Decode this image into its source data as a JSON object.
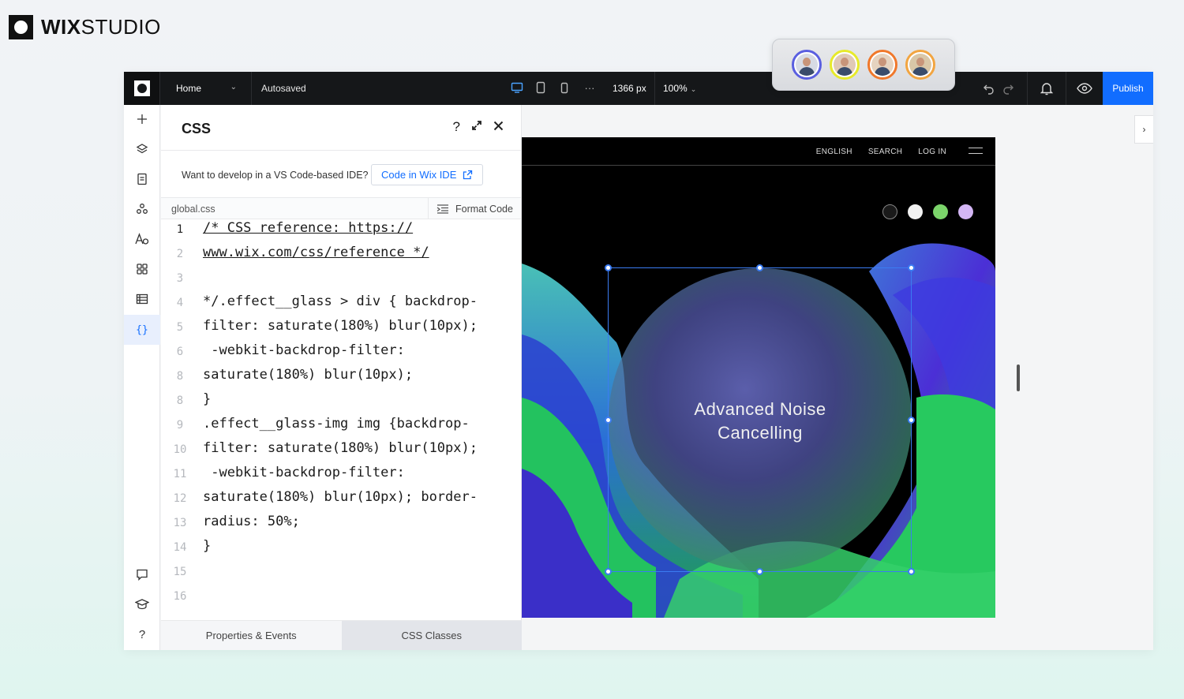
{
  "brand": {
    "bold": "WIX",
    "light": "STUDIO"
  },
  "topbar": {
    "page": "Home",
    "status": "Autosaved",
    "width": "1366 px",
    "zoom": "100%",
    "more": "···",
    "publish": "Publish"
  },
  "collaborators": [
    {
      "ring": "#5a5fe0",
      "bg": "#d7dbe4"
    },
    {
      "ring": "#e7ea2b",
      "bg": "#e0c9b6"
    },
    {
      "ring": "#f0782b",
      "bg": "#e5d3c0"
    },
    {
      "ring": "#f2a541",
      "bg": "#d9c7a8"
    }
  ],
  "panel": {
    "title": "CSS",
    "ide_prompt": "Want to develop in a VS Code-based IDE?",
    "ide_button": "Code in Wix IDE",
    "file": "global.css",
    "format": "Format Code",
    "lines": [
      {
        "n": "1",
        "t": "/* CSS reference: https://"
      },
      {
        "n": "2",
        "t": "www.wix.com/css/reference */"
      },
      {
        "n": "3",
        "t": ""
      },
      {
        "n": "4",
        "t": "*/.effect__glass > div { backdrop-"
      },
      {
        "n": "5",
        "t": "filter: saturate(180%) blur(10px);"
      },
      {
        "n": "6",
        "t": " -webkit-backdrop-filter:"
      },
      {
        "n": "8",
        "t": "saturate(180%) blur(10px);"
      },
      {
        "n": "8",
        "t": "}"
      },
      {
        "n": "9",
        "t": ".effect__glass-img img {backdrop-"
      },
      {
        "n": "10",
        "t": "filter: saturate(180%) blur(10px);"
      },
      {
        "n": "11",
        "t": " -webkit-backdrop-filter:"
      },
      {
        "n": "12",
        "t": "saturate(180%) blur(10px); border-"
      },
      {
        "n": "13",
        "t": "radius: 50%;"
      },
      {
        "n": "14",
        "t": "}"
      },
      {
        "n": "15",
        "t": ""
      },
      {
        "n": "16",
        "t": ""
      }
    ],
    "tabs": [
      "Properties & Events",
      "CSS Classes"
    ]
  },
  "site": {
    "nav": [
      "ENGLISH",
      "SEARCH",
      "LOG IN"
    ],
    "swatches": [
      "#1a1a1a",
      "#f2f2f2",
      "#7bd46a",
      "#d4b6f5"
    ],
    "hero": "Advanced Noise Cancelling"
  }
}
